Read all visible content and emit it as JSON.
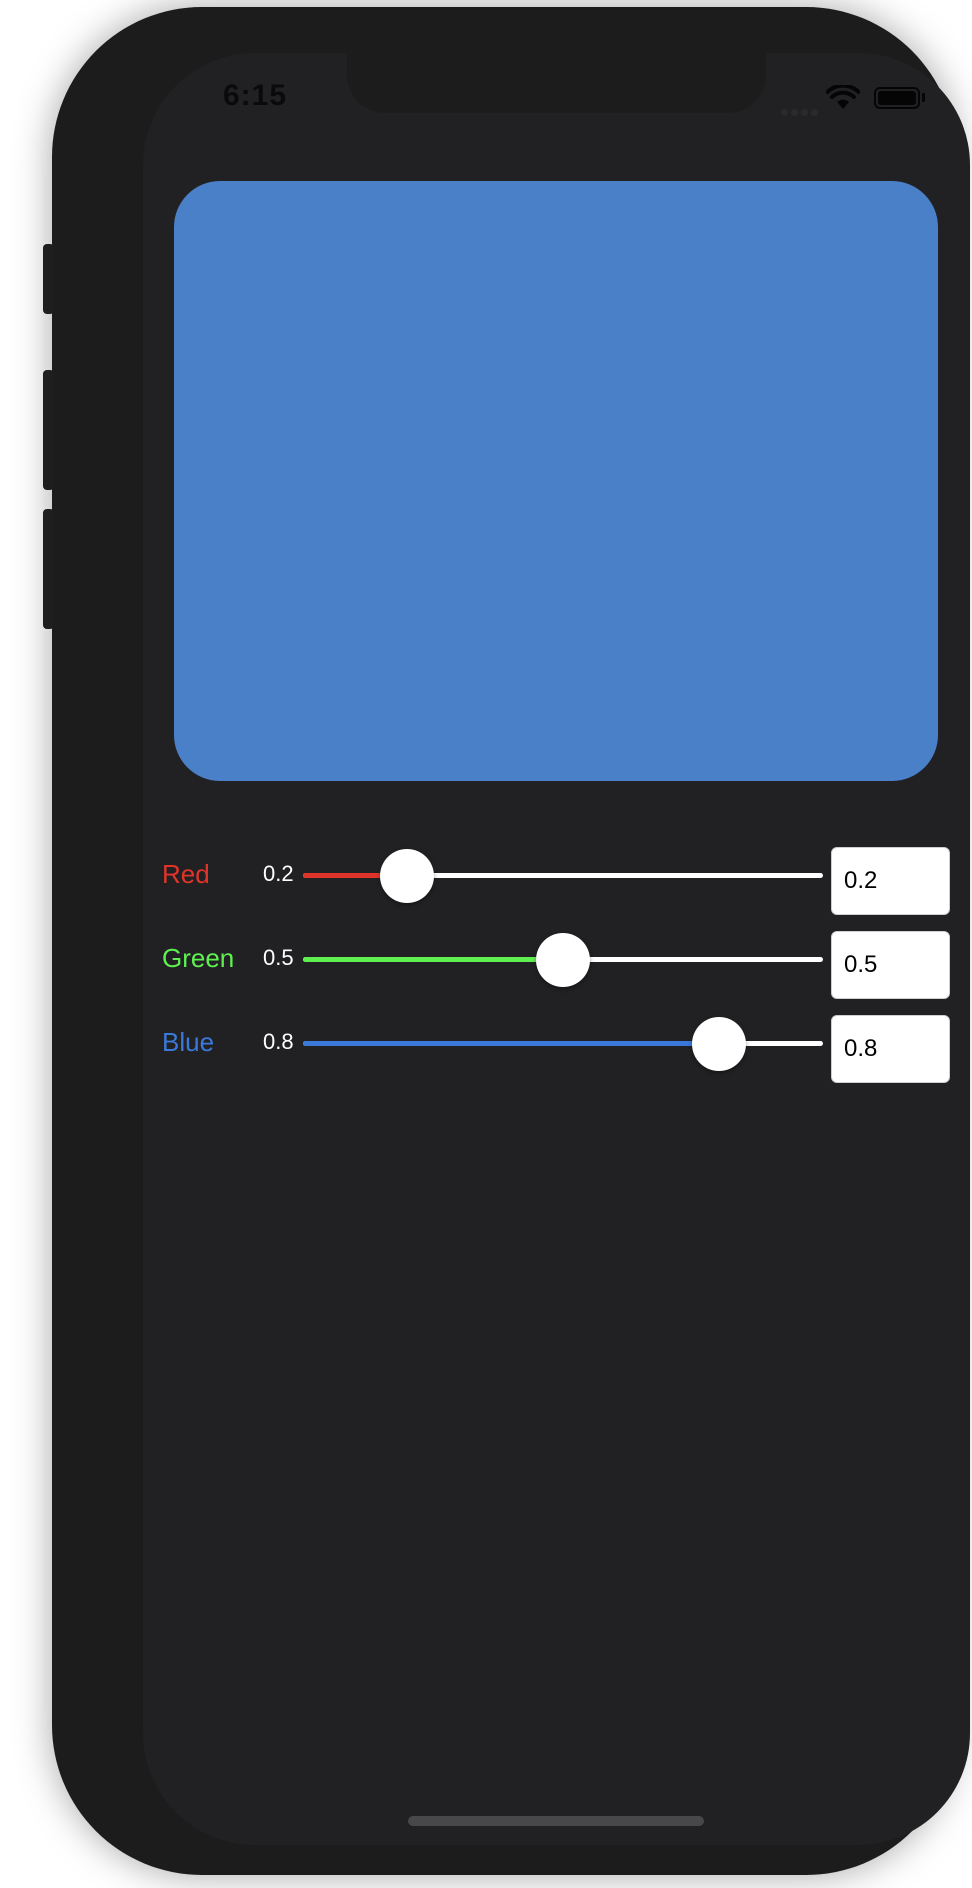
{
  "status_bar": {
    "time": "6:15",
    "icons": [
      "cellular-dots-icon",
      "wifi-icon",
      "battery-icon"
    ]
  },
  "preview": {
    "color": "#4a80c7"
  },
  "channels": [
    {
      "name": "Red",
      "value_text": "0.2",
      "field_value": "0.2",
      "value": 0.2,
      "label_color": "#e0342a",
      "track_color": "#e0342a"
    },
    {
      "name": "Green",
      "value_text": "0.5",
      "field_value": "0.5",
      "value": 0.5,
      "label_color": "#5ff050",
      "track_color": "#5ff050"
    },
    {
      "name": "Blue",
      "value_text": "0.8",
      "field_value": "0.8",
      "value": 0.8,
      "label_color": "#3a79da",
      "track_color": "#3a79da"
    }
  ]
}
